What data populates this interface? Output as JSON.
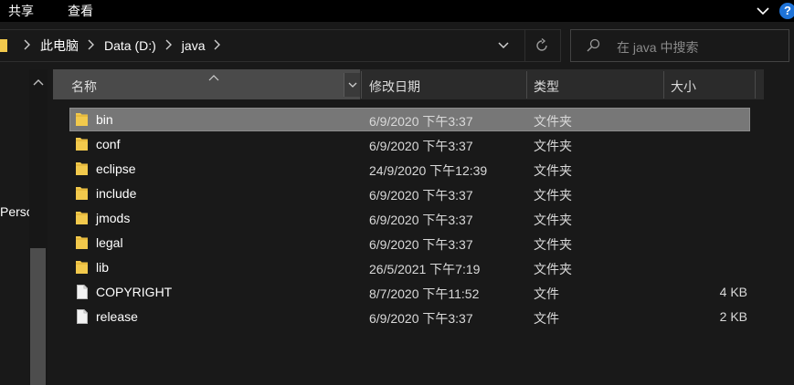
{
  "ribbon": {
    "tabs": [
      "共享",
      "查看"
    ],
    "help": "?"
  },
  "address": {
    "crumbs": [
      "此电脑",
      "Data (D:)",
      "java"
    ]
  },
  "search": {
    "placeholder": "在 java 中搜索"
  },
  "nav": {
    "partial_label": "Persc"
  },
  "columns": {
    "name": "名称",
    "modified": "修改日期",
    "type": "类型",
    "size": "大小"
  },
  "files": [
    {
      "name": "bin",
      "modified": "6/9/2020 下午3:37",
      "type": "文件夹",
      "size": "",
      "kind": "folder",
      "selected": true
    },
    {
      "name": "conf",
      "modified": "6/9/2020 下午3:37",
      "type": "文件夹",
      "size": "",
      "kind": "folder"
    },
    {
      "name": "eclipse",
      "modified": "24/9/2020 下午12:39",
      "type": "文件夹",
      "size": "",
      "kind": "folder"
    },
    {
      "name": "include",
      "modified": "6/9/2020 下午3:37",
      "type": "文件夹",
      "size": "",
      "kind": "folder"
    },
    {
      "name": "jmods",
      "modified": "6/9/2020 下午3:37",
      "type": "文件夹",
      "size": "",
      "kind": "folder"
    },
    {
      "name": "legal",
      "modified": "6/9/2020 下午3:37",
      "type": "文件夹",
      "size": "",
      "kind": "folder"
    },
    {
      "name": "lib",
      "modified": "26/5/2021 下午7:19",
      "type": "文件夹",
      "size": "",
      "kind": "folder"
    },
    {
      "name": "COPYRIGHT",
      "modified": "8/7/2020 下午11:52",
      "type": "文件",
      "size": "4 KB",
      "kind": "file"
    },
    {
      "name": "release",
      "modified": "6/9/2020 下午3:37",
      "type": "文件",
      "size": "2 KB",
      "kind": "file"
    }
  ],
  "colors": {
    "accent": "#1e73d8",
    "folder": "#f2c94c",
    "selection": "#777777"
  }
}
